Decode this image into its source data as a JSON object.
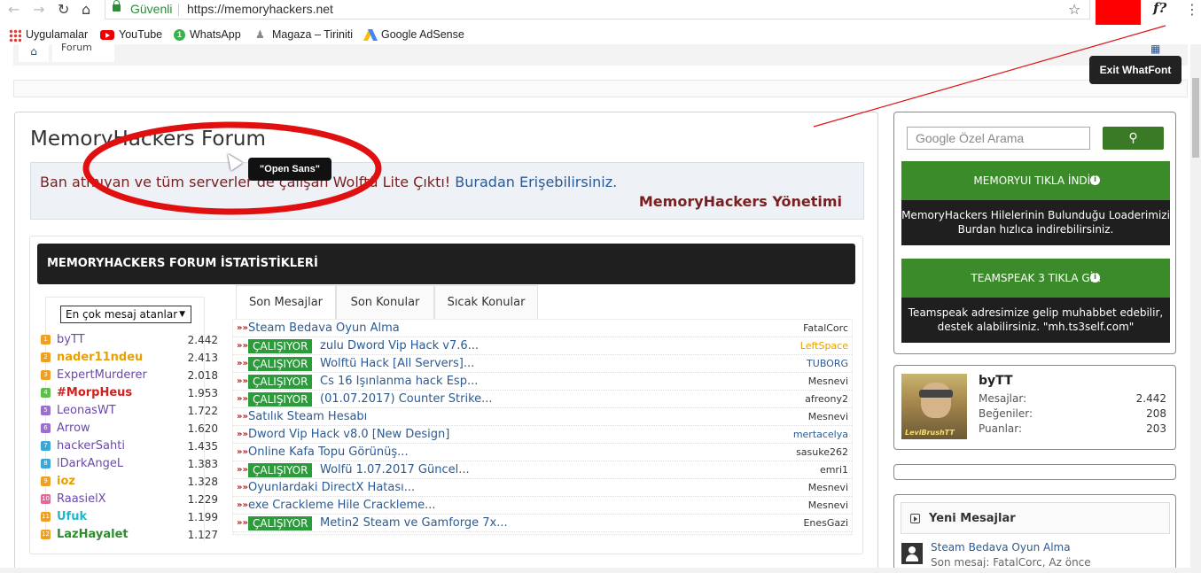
{
  "browser": {
    "secure_label": "Güvenli",
    "url": "https://memoryhackers.net",
    "whatfont_button": "f?",
    "bookmarks": [
      "Uygulamalar",
      "YouTube",
      "WhatsApp",
      "Magaza – Tiriniti",
      "Google AdSense"
    ]
  },
  "breadcrumb": {
    "forum_label": "Forum"
  },
  "whatfont": {
    "exit_label": "Exit WhatFont",
    "font_tooltip": "\"Open Sans\""
  },
  "forum": {
    "title": "MemoryHackers Forum",
    "notice_text": "Ban atmıyan ve tüm serverler de çalışan Wolftü Lite Çıktı! ",
    "notice_link": "Buradan Erişebilirsiniz.",
    "notice_sign": "MemoryHackers Yönetimi",
    "stats_heading": "MEMORYHACKERS FORUM İSTATİSTİKLERİ"
  },
  "top_posters": {
    "dropdown_value": "En çok mesaj atanlar",
    "users": [
      {
        "rank": "1",
        "name": "byTT",
        "count": "2.442",
        "color": "#6a4aa8",
        "badge": "#f0a020"
      },
      {
        "rank": "2",
        "name": "nader11ndeu",
        "count": "2.413",
        "color": "#e8a000",
        "badge": "#f0a020"
      },
      {
        "rank": "3",
        "name": "ExpertMurderer",
        "count": "2.018",
        "color": "#6a4aa8",
        "badge": "#f0a020"
      },
      {
        "rank": "4",
        "name": "#MorpHeus",
        "count": "1.953",
        "color": "#d02020",
        "badge": "#5bbf4a"
      },
      {
        "rank": "5",
        "name": "LeonasWT",
        "count": "1.722",
        "color": "#6a4aa8",
        "badge": "#9b6fd0"
      },
      {
        "rank": "6",
        "name": "Arrow",
        "count": "1.620",
        "color": "#6a4aa8",
        "badge": "#9b6fd0"
      },
      {
        "rank": "7",
        "name": "hackerSahti",
        "count": "1.435",
        "color": "#6a4aa8",
        "badge": "#39a8d8"
      },
      {
        "rank": "8",
        "name": "lDarkAngeL",
        "count": "1.383",
        "color": "#6a4aa8",
        "badge": "#39a8d8"
      },
      {
        "rank": "9",
        "name": "ioz",
        "count": "1.328",
        "color": "#e8a000",
        "badge": "#f0a020"
      },
      {
        "rank": "10",
        "name": "RaasielX",
        "count": "1.229",
        "color": "#6a4aa8",
        "badge": "#e06a9a"
      },
      {
        "rank": "11",
        "name": "Ufuk",
        "count": "1.199",
        "color": "#1fb8c8",
        "badge": "#f0a020"
      },
      {
        "rank": "12",
        "name": "LazHayalet",
        "count": "1.127",
        "color": "#2e8b2e",
        "badge": "#f0a020"
      }
    ]
  },
  "tabs": [
    "Son Mesajlar",
    "Son Konular",
    "Sıcak Konular"
  ],
  "messages": [
    {
      "badge": "",
      "title": "Steam Bedava Oyun Alma",
      "author": "FatalCorc",
      "author_color": "#333333"
    },
    {
      "badge": "ÇALIŞIYOR",
      "title": "zulu Dword Vip Hack v7.6...",
      "author": "LeftSpace",
      "author_color": "#e8a000"
    },
    {
      "badge": "ÇALIŞIYOR",
      "title": "Wolftü Hack [All Servers]...",
      "author": "TUBORG",
      "author_color": "#2b5a93"
    },
    {
      "badge": "ÇALIŞIYOR",
      "title": "Cs 16 Işınlanma hack Esp...",
      "author": "Mesnevi",
      "author_color": "#333333"
    },
    {
      "badge": "ÇALIŞIYOR",
      "title": "(01.07.2017) Counter Strike...",
      "author": "afreony2",
      "author_color": "#333333"
    },
    {
      "badge": "",
      "title": "Satılık Steam Hesabı",
      "author": "Mesnevi",
      "author_color": "#333333"
    },
    {
      "badge": "",
      "title": "Dword Vip Hack v8.0 [New Design]",
      "author": "mertacelya",
      "author_color": "#2b5a93"
    },
    {
      "badge": "",
      "title": "Online Kafa Topu Görünüş...",
      "author": "sasuke262",
      "author_color": "#333333"
    },
    {
      "badge": "ÇALIŞIYOR",
      "title": "Wolfü 1.07.2017 Güncel...",
      "author": "emri1",
      "author_color": "#333333"
    },
    {
      "badge": "",
      "title": "Oyunlardaki DirectX Hatası...",
      "author": "Mesnevi",
      "author_color": "#333333"
    },
    {
      "badge": "",
      "title": "exe Crackleme Hile Crackleme...",
      "author": "Mesnevi",
      "author_color": "#333333"
    },
    {
      "badge": "ÇALIŞIYOR",
      "title": "Metin2 Steam ve Gamforge 7x...",
      "author": "EnesGazi",
      "author_color": "#333333"
    }
  ],
  "sidebar": {
    "search_placeholder": "Google Özel Arama",
    "promos": [
      {
        "head": "MEMORYUI TIKLA İNDİR",
        "body": "MemoryHackers Hilelerinin Bulunduğu Loaderimizi Burdan hızlıca indirebilirsiniz."
      },
      {
        "head": "TEAMSPEAK 3 TIKLA GİR",
        "body": "Teamspeak adresimize gelip muhabbet edebilir, destek alabilirsiniz. \"mh.ts3self.com\""
      }
    ],
    "user": {
      "name": "byTT",
      "avatar_tag": "LeviBrushTT",
      "stats": [
        {
          "label": "Mesajlar:",
          "value": "2.442"
        },
        {
          "label": "Beğeniler:",
          "value": "208"
        },
        {
          "label": "Puanlar:",
          "value": "203"
        }
      ]
    },
    "new_messages": {
      "heading": "Yeni Mesajlar",
      "item_title": "Steam Bedava Oyun Alma",
      "item_sub": "Son mesaj: FatalCorc, Az önce"
    }
  }
}
